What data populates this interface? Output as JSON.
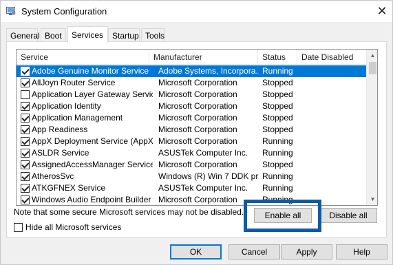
{
  "window": {
    "title": "System Configuration",
    "close_glyph": "✕"
  },
  "tabs": [
    {
      "label": "General",
      "active": false
    },
    {
      "label": "Boot",
      "active": false
    },
    {
      "label": "Services",
      "active": true
    },
    {
      "label": "Startup",
      "active": false
    },
    {
      "label": "Tools",
      "active": false
    }
  ],
  "services_list": {
    "columns": {
      "service": "Service",
      "manufacturer": "Manufacturer",
      "status": "Status",
      "date_disabled": "Date Disabled"
    },
    "rows": [
      {
        "checked": true,
        "service": "Adobe Genuine Monitor Service",
        "manufacturer": "Adobe Systems, Incorpora...",
        "status": "Running",
        "date_disabled": "",
        "selected": true
      },
      {
        "checked": true,
        "service": "AllJoyn Router Service",
        "manufacturer": "Microsoft Corporation",
        "status": "Stopped",
        "date_disabled": "",
        "selected": false
      },
      {
        "checked": false,
        "service": "Application Layer Gateway Service",
        "manufacturer": "Microsoft Corporation",
        "status": "Stopped",
        "date_disabled": "",
        "selected": false
      },
      {
        "checked": true,
        "service": "Application Identity",
        "manufacturer": "Microsoft Corporation",
        "status": "Stopped",
        "date_disabled": "",
        "selected": false
      },
      {
        "checked": true,
        "service": "Application Management",
        "manufacturer": "Microsoft Corporation",
        "status": "Stopped",
        "date_disabled": "",
        "selected": false
      },
      {
        "checked": true,
        "service": "App Readiness",
        "manufacturer": "Microsoft Corporation",
        "status": "Stopped",
        "date_disabled": "",
        "selected": false
      },
      {
        "checked": true,
        "service": "AppX Deployment Service (AppX...",
        "manufacturer": "Microsoft Corporation",
        "status": "Running",
        "date_disabled": "",
        "selected": false
      },
      {
        "checked": true,
        "service": "ASLDR Service",
        "manufacturer": "ASUSTek Computer Inc.",
        "status": "Running",
        "date_disabled": "",
        "selected": false
      },
      {
        "checked": true,
        "service": "AssignedAccessManager Service",
        "manufacturer": "Microsoft Corporation",
        "status": "Stopped",
        "date_disabled": "",
        "selected": false
      },
      {
        "checked": true,
        "service": "AtherosSvc",
        "manufacturer": "Windows (R) Win 7 DDK pr...",
        "status": "Running",
        "date_disabled": "",
        "selected": false
      },
      {
        "checked": true,
        "service": "ATKGFNEX Service",
        "manufacturer": "ASUSTek Computer Inc.",
        "status": "Running",
        "date_disabled": "",
        "selected": false
      },
      {
        "checked": true,
        "service": "Windows Audio Endpoint Builder",
        "manufacturer": "Microsoft Corporation",
        "status": "Running",
        "date_disabled": "",
        "selected": false
      }
    ]
  },
  "note": "Note that some secure Microsoft services may not be disabled.",
  "hide_ms_label": "Hide all Microsoft services",
  "hide_ms_checked": false,
  "buttons": {
    "enable_all": "Enable all",
    "disable_all": "Disable all",
    "ok": "OK",
    "cancel": "Cancel",
    "apply": "Apply",
    "help": "Help"
  },
  "colors": {
    "selection": "#0078d7",
    "highlight_box": "#0e5aa7"
  }
}
